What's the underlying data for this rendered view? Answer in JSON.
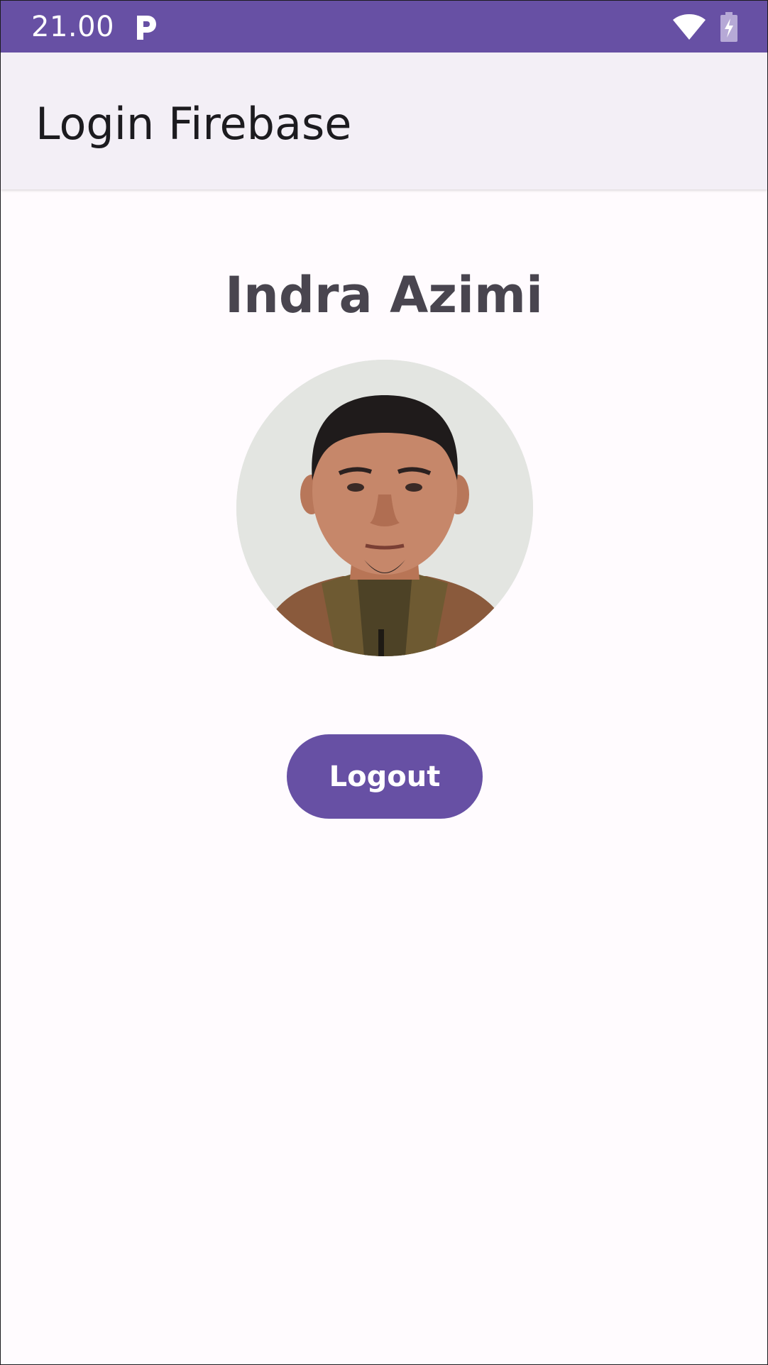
{
  "status_bar": {
    "time": "21.00",
    "background": "#6750a4",
    "icons": [
      "parking-p-icon",
      "wifi-icon",
      "battery-charging-icon"
    ]
  },
  "app_bar": {
    "title": "Login Firebase",
    "background": "#f3eff6"
  },
  "profile": {
    "name": "Indra Azimi",
    "avatar_icon": "profile-photo"
  },
  "actions": {
    "logout_label": "Logout",
    "button_color": "#6750a4"
  }
}
